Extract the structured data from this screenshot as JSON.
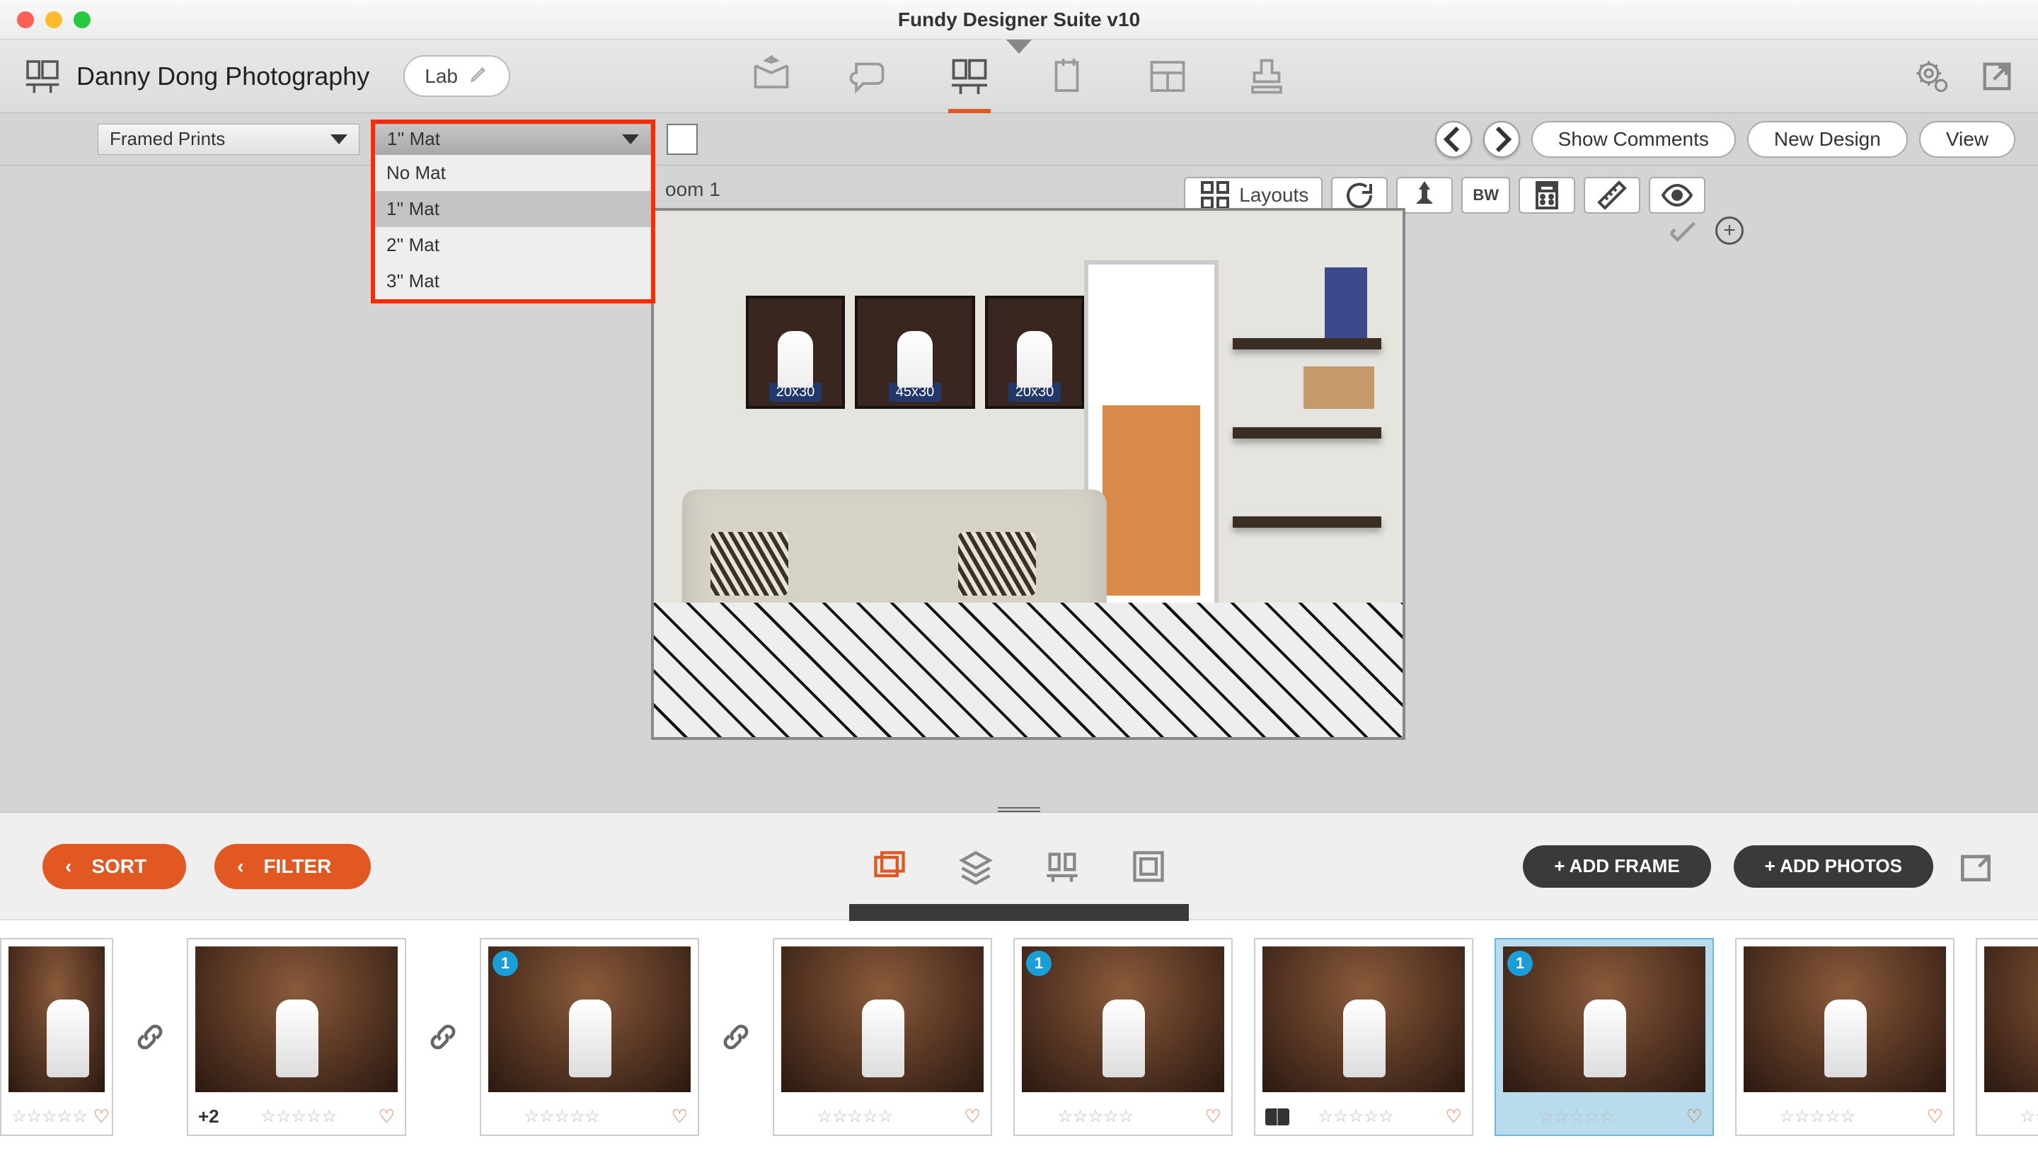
{
  "window": {
    "title": "Fundy Designer Suite v10"
  },
  "toolbar": {
    "project": "Danny Dong Photography",
    "lab": "Lab"
  },
  "subbar": {
    "print_type": "Framed Prints",
    "mat_selected": "1'' Mat",
    "mat_options": [
      "No Mat",
      "1'' Mat",
      "2'' Mat",
      "3'' Mat"
    ],
    "show_comments": "Show Comments",
    "new_design": "New Design",
    "view": "View"
  },
  "canvas": {
    "room_label": "oom 1",
    "layouts_label": "Layouts",
    "bw_label": "BW",
    "frame_sizes": [
      "20x30",
      "45x30",
      "20x30"
    ]
  },
  "bottombar": {
    "sort": "SORT",
    "filter": "FILTER",
    "add_frame": "+ ADD FRAME",
    "add_photos": "+ ADD PHOTOS"
  },
  "filmstrip": {
    "thumbs": [
      {
        "plus": "",
        "badge": "",
        "stars": 5,
        "heart": true,
        "link_after": true,
        "partial": "first"
      },
      {
        "plus": "+2",
        "badge": "",
        "stars": 5,
        "heart": true,
        "link_after": true
      },
      {
        "plus": "",
        "badge": "1",
        "stars": 5,
        "heart": true,
        "link_after": true
      },
      {
        "plus": "",
        "badge": "",
        "stars": 5,
        "heart": true
      },
      {
        "plus": "",
        "badge": "1",
        "stars": 5,
        "heart": true
      },
      {
        "plus": "",
        "badge": "",
        "stars": 5,
        "heart": true,
        "book": true
      },
      {
        "plus": "",
        "badge": "1",
        "stars": 5,
        "heart": true,
        "selected": true
      },
      {
        "plus": "",
        "badge": "",
        "stars": 5,
        "heart": true
      },
      {
        "plus": "",
        "badge": "",
        "stars": 5,
        "heart": true
      },
      {
        "plus": "",
        "badge": "",
        "stars": 0,
        "heart": false,
        "partial": "last"
      }
    ]
  }
}
